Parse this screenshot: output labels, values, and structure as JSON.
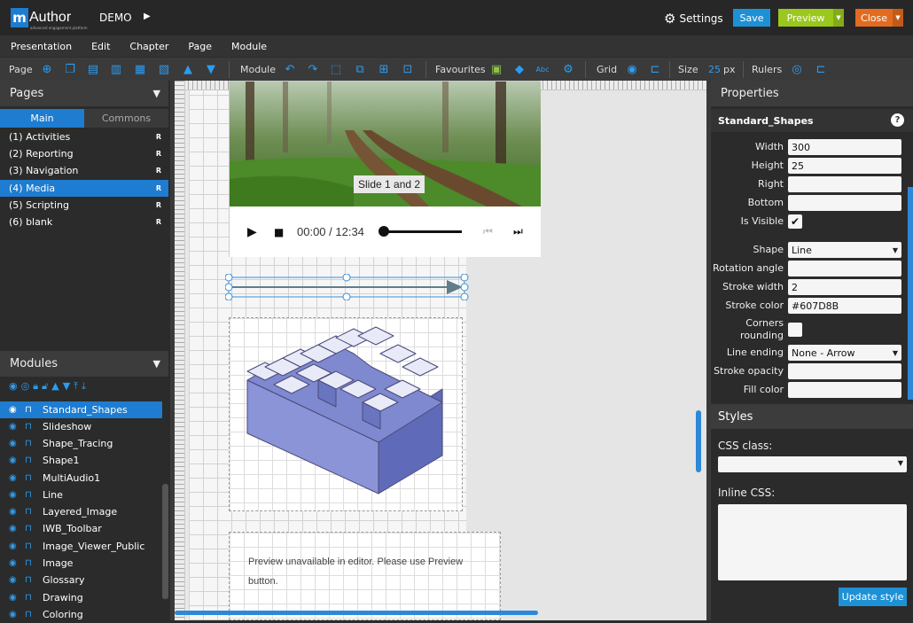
{
  "app": {
    "logo_letter": "m",
    "logo_name": "Author",
    "logo_tagline": "advanced engagement platform",
    "project": "DEMO",
    "settings_label": "Settings",
    "save_label": "Save",
    "preview_label": "Preview",
    "close_label": "Close"
  },
  "menu": [
    "Presentation",
    "Edit",
    "Chapter",
    "Page",
    "Module"
  ],
  "toolbar": {
    "page_label": "Page",
    "module_label": "Module",
    "favourites_label": "Favourites",
    "grid_label": "Grid",
    "size_label": "Size",
    "size_value": "25",
    "size_unit": "px",
    "rulers_label": "Rulers"
  },
  "pages_panel": {
    "title": "Pages",
    "tabs": [
      "Main",
      "Commons"
    ],
    "items": [
      {
        "label": "(1) Activities",
        "flag": "R"
      },
      {
        "label": "(2) Reporting",
        "flag": "R"
      },
      {
        "label": "(3) Navigation",
        "flag": "R"
      },
      {
        "label": "(4) Media",
        "flag": "R"
      },
      {
        "label": "(5) Scripting",
        "flag": "R"
      },
      {
        "label": "(6) blank",
        "flag": "R"
      }
    ]
  },
  "modules_panel": {
    "title": "Modules",
    "items": [
      "Standard_Shapes",
      "Slideshow",
      "Shape_Tracing",
      "Shape1",
      "MultiAudio1",
      "Line",
      "Layered_Image",
      "IWB_Toolbar",
      "Image_Viewer_Public",
      "Image",
      "Glossary",
      "Drawing",
      "Coloring"
    ]
  },
  "canvas": {
    "slide_caption": "Slide 1 and 2",
    "player_time": "00:00 / 12:34",
    "preview_text": "Preview unavailable in editor. Please use Preview button."
  },
  "properties": {
    "title": "Properties",
    "module_name": "Standard_Shapes",
    "rows": [
      {
        "label": "Width",
        "value": "300"
      },
      {
        "label": "Height",
        "value": "25"
      },
      {
        "label": "Right",
        "value": ""
      },
      {
        "label": "Bottom",
        "value": ""
      }
    ],
    "is_visible_label": "Is Visible",
    "shape_label": "Shape",
    "shape_value": "Line",
    "rotation_label": "Rotation angle",
    "stroke_width_label": "Stroke width",
    "stroke_width_value": "2",
    "stroke_color_label": "Stroke color",
    "stroke_color_value": "#607D8B",
    "corners_label_1": "Corners",
    "corners_label_2": "rounding",
    "line_ending_label": "Line ending",
    "line_ending_value": "None - Arrow",
    "stroke_opacity_label": "Stroke opacity",
    "fill_color_label": "Fill color"
  },
  "styles": {
    "title": "Styles",
    "css_class_label": "CSS class:",
    "inline_css_label": "Inline CSS:",
    "update_label": "Update style"
  },
  "colors": {
    "accent": "#1e7cd1",
    "save": "#1e91d6",
    "preview": "#9ac81d",
    "close": "#e36b1f",
    "line_stroke": "#607D8B"
  }
}
